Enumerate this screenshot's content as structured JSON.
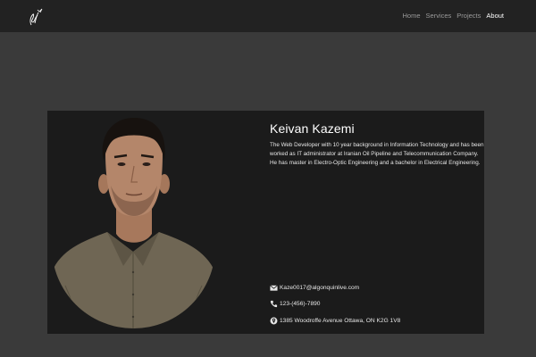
{
  "nav": {
    "links": [
      {
        "label": "Home"
      },
      {
        "label": "Services"
      },
      {
        "label": "Projects"
      },
      {
        "label": "About"
      }
    ]
  },
  "profile": {
    "name": "Keivan Kazemi",
    "bio": "The Web Developer with 10 year background in Information Technology and has been worked as IT administrator at Iranian Oil Pipeline and Telecommunication Company. He has master in Electro-Optic Engineering and a bachelor in Electrical Engineering.",
    "photo_icon": "portrait-photo"
  },
  "contact": {
    "email": "Kaze0017@algonquinlive.com",
    "phone": "123-(456)-7890",
    "address": "1385 Woodroffe Avenue Ottawa, ON K2G 1V8"
  },
  "colors": {
    "page_bg": "#3a3a3a",
    "navbar_bg": "#222222",
    "card_bg": "#1b1b1b",
    "nav_inactive": "#9a9a9a",
    "nav_active": "#ffffff"
  }
}
